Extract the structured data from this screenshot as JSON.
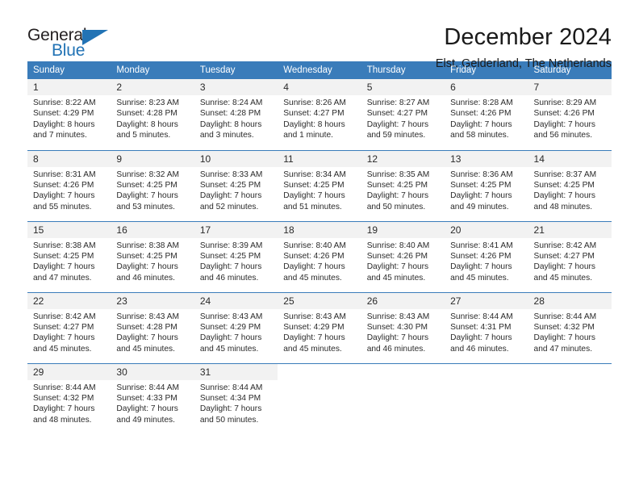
{
  "brand": {
    "name_top": "General",
    "name_bottom": "Blue",
    "accent_color": "#2273b5"
  },
  "header": {
    "title": "December 2024",
    "subtitle": "Elst, Gelderland, The Netherlands"
  },
  "calendar": {
    "header_bg": "#3a7cba",
    "daynum_bg": "#f2f2f2",
    "weekdays": [
      "Sunday",
      "Monday",
      "Tuesday",
      "Wednesday",
      "Thursday",
      "Friday",
      "Saturday"
    ],
    "weeks": [
      [
        {
          "day": "1",
          "lines": [
            "Sunrise: 8:22 AM",
            "Sunset: 4:29 PM",
            "Daylight: 8 hours",
            "and 7 minutes."
          ]
        },
        {
          "day": "2",
          "lines": [
            "Sunrise: 8:23 AM",
            "Sunset: 4:28 PM",
            "Daylight: 8 hours",
            "and 5 minutes."
          ]
        },
        {
          "day": "3",
          "lines": [
            "Sunrise: 8:24 AM",
            "Sunset: 4:28 PM",
            "Daylight: 8 hours",
            "and 3 minutes."
          ]
        },
        {
          "day": "4",
          "lines": [
            "Sunrise: 8:26 AM",
            "Sunset: 4:27 PM",
            "Daylight: 8 hours",
            "and 1 minute."
          ]
        },
        {
          "day": "5",
          "lines": [
            "Sunrise: 8:27 AM",
            "Sunset: 4:27 PM",
            "Daylight: 7 hours",
            "and 59 minutes."
          ]
        },
        {
          "day": "6",
          "lines": [
            "Sunrise: 8:28 AM",
            "Sunset: 4:26 PM",
            "Daylight: 7 hours",
            "and 58 minutes."
          ]
        },
        {
          "day": "7",
          "lines": [
            "Sunrise: 8:29 AM",
            "Sunset: 4:26 PM",
            "Daylight: 7 hours",
            "and 56 minutes."
          ]
        }
      ],
      [
        {
          "day": "8",
          "lines": [
            "Sunrise: 8:31 AM",
            "Sunset: 4:26 PM",
            "Daylight: 7 hours",
            "and 55 minutes."
          ]
        },
        {
          "day": "9",
          "lines": [
            "Sunrise: 8:32 AM",
            "Sunset: 4:25 PM",
            "Daylight: 7 hours",
            "and 53 minutes."
          ]
        },
        {
          "day": "10",
          "lines": [
            "Sunrise: 8:33 AM",
            "Sunset: 4:25 PM",
            "Daylight: 7 hours",
            "and 52 minutes."
          ]
        },
        {
          "day": "11",
          "lines": [
            "Sunrise: 8:34 AM",
            "Sunset: 4:25 PM",
            "Daylight: 7 hours",
            "and 51 minutes."
          ]
        },
        {
          "day": "12",
          "lines": [
            "Sunrise: 8:35 AM",
            "Sunset: 4:25 PM",
            "Daylight: 7 hours",
            "and 50 minutes."
          ]
        },
        {
          "day": "13",
          "lines": [
            "Sunrise: 8:36 AM",
            "Sunset: 4:25 PM",
            "Daylight: 7 hours",
            "and 49 minutes."
          ]
        },
        {
          "day": "14",
          "lines": [
            "Sunrise: 8:37 AM",
            "Sunset: 4:25 PM",
            "Daylight: 7 hours",
            "and 48 minutes."
          ]
        }
      ],
      [
        {
          "day": "15",
          "lines": [
            "Sunrise: 8:38 AM",
            "Sunset: 4:25 PM",
            "Daylight: 7 hours",
            "and 47 minutes."
          ]
        },
        {
          "day": "16",
          "lines": [
            "Sunrise: 8:38 AM",
            "Sunset: 4:25 PM",
            "Daylight: 7 hours",
            "and 46 minutes."
          ]
        },
        {
          "day": "17",
          "lines": [
            "Sunrise: 8:39 AM",
            "Sunset: 4:25 PM",
            "Daylight: 7 hours",
            "and 46 minutes."
          ]
        },
        {
          "day": "18",
          "lines": [
            "Sunrise: 8:40 AM",
            "Sunset: 4:26 PM",
            "Daylight: 7 hours",
            "and 45 minutes."
          ]
        },
        {
          "day": "19",
          "lines": [
            "Sunrise: 8:40 AM",
            "Sunset: 4:26 PM",
            "Daylight: 7 hours",
            "and 45 minutes."
          ]
        },
        {
          "day": "20",
          "lines": [
            "Sunrise: 8:41 AM",
            "Sunset: 4:26 PM",
            "Daylight: 7 hours",
            "and 45 minutes."
          ]
        },
        {
          "day": "21",
          "lines": [
            "Sunrise: 8:42 AM",
            "Sunset: 4:27 PM",
            "Daylight: 7 hours",
            "and 45 minutes."
          ]
        }
      ],
      [
        {
          "day": "22",
          "lines": [
            "Sunrise: 8:42 AM",
            "Sunset: 4:27 PM",
            "Daylight: 7 hours",
            "and 45 minutes."
          ]
        },
        {
          "day": "23",
          "lines": [
            "Sunrise: 8:43 AM",
            "Sunset: 4:28 PM",
            "Daylight: 7 hours",
            "and 45 minutes."
          ]
        },
        {
          "day": "24",
          "lines": [
            "Sunrise: 8:43 AM",
            "Sunset: 4:29 PM",
            "Daylight: 7 hours",
            "and 45 minutes."
          ]
        },
        {
          "day": "25",
          "lines": [
            "Sunrise: 8:43 AM",
            "Sunset: 4:29 PM",
            "Daylight: 7 hours",
            "and 45 minutes."
          ]
        },
        {
          "day": "26",
          "lines": [
            "Sunrise: 8:43 AM",
            "Sunset: 4:30 PM",
            "Daylight: 7 hours",
            "and 46 minutes."
          ]
        },
        {
          "day": "27",
          "lines": [
            "Sunrise: 8:44 AM",
            "Sunset: 4:31 PM",
            "Daylight: 7 hours",
            "and 46 minutes."
          ]
        },
        {
          "day": "28",
          "lines": [
            "Sunrise: 8:44 AM",
            "Sunset: 4:32 PM",
            "Daylight: 7 hours",
            "and 47 minutes."
          ]
        }
      ],
      [
        {
          "day": "29",
          "lines": [
            "Sunrise: 8:44 AM",
            "Sunset: 4:32 PM",
            "Daylight: 7 hours",
            "and 48 minutes."
          ]
        },
        {
          "day": "30",
          "lines": [
            "Sunrise: 8:44 AM",
            "Sunset: 4:33 PM",
            "Daylight: 7 hours",
            "and 49 minutes."
          ]
        },
        {
          "day": "31",
          "lines": [
            "Sunrise: 8:44 AM",
            "Sunset: 4:34 PM",
            "Daylight: 7 hours",
            "and 50 minutes."
          ]
        },
        {
          "day": "",
          "lines": []
        },
        {
          "day": "",
          "lines": []
        },
        {
          "day": "",
          "lines": []
        },
        {
          "day": "",
          "lines": []
        }
      ]
    ]
  }
}
